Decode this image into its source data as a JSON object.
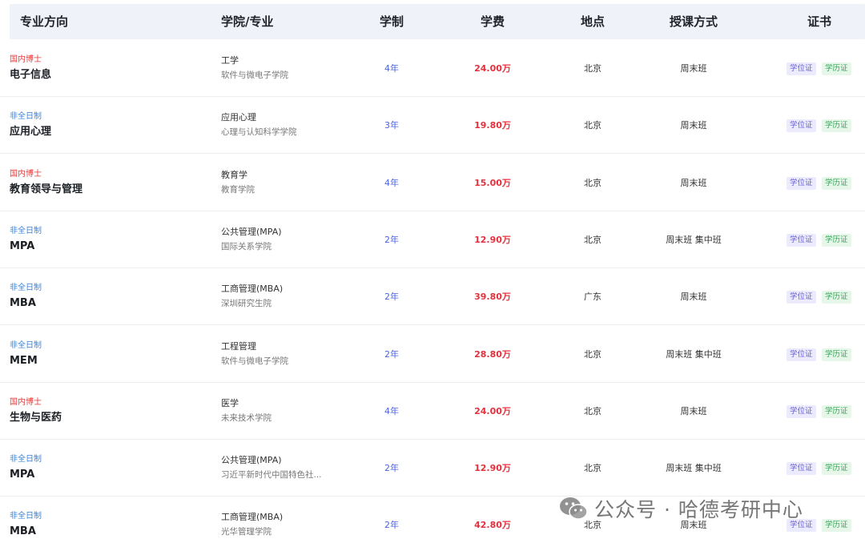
{
  "header": {
    "col_direction": "专业方向",
    "col_program": "学院/专业",
    "col_years": "学制",
    "col_fee": "学费",
    "col_location": "地点",
    "col_mode": "授课方式",
    "col_cert": "证书"
  },
  "rows": [
    {
      "tag": "国内博士",
      "tag_type": "doc",
      "major": "电子信息",
      "program": "工学",
      "school": "软件与微电子学院",
      "years": "4年",
      "fee": "24.00万",
      "location": "北京",
      "mode": "周末班",
      "cert1": "学位证",
      "cert2": "学历证"
    },
    {
      "tag": "非全日制",
      "tag_type": "part",
      "major": "应用心理",
      "program": "应用心理",
      "school": "心理与认知科学学院",
      "years": "3年",
      "fee": "19.80万",
      "location": "北京",
      "mode": "周末班",
      "cert1": "学位证",
      "cert2": "学历证"
    },
    {
      "tag": "国内博士",
      "tag_type": "doc",
      "major": "教育领导与管理",
      "program": "教育学",
      "school": "教育学院",
      "years": "4年",
      "fee": "15.00万",
      "location": "北京",
      "mode": "周末班",
      "cert1": "学位证",
      "cert2": "学历证"
    },
    {
      "tag": "非全日制",
      "tag_type": "part",
      "major": "MPA",
      "program": "公共管理(MPA)",
      "school": "国际关系学院",
      "years": "2年",
      "fee": "12.90万",
      "location": "北京",
      "mode": "周末班 集中班",
      "cert1": "学位证",
      "cert2": "学历证"
    },
    {
      "tag": "非全日制",
      "tag_type": "part",
      "major": "MBA",
      "program": "工商管理(MBA)",
      "school": "深圳研究生院",
      "years": "2年",
      "fee": "39.80万",
      "location": "广东",
      "mode": "周末班",
      "cert1": "学位证",
      "cert2": "学历证"
    },
    {
      "tag": "非全日制",
      "tag_type": "part",
      "major": "MEM",
      "program": "工程管理",
      "school": "软件与微电子学院",
      "years": "2年",
      "fee": "28.80万",
      "location": "北京",
      "mode": "周末班 集中班",
      "cert1": "学位证",
      "cert2": "学历证"
    },
    {
      "tag": "国内博士",
      "tag_type": "doc",
      "major": "生物与医药",
      "program": "医学",
      "school": "未来技术学院",
      "years": "4年",
      "fee": "24.00万",
      "location": "北京",
      "mode": "周末班",
      "cert1": "学位证",
      "cert2": "学历证"
    },
    {
      "tag": "非全日制",
      "tag_type": "part",
      "major": "MPA",
      "program": "公共管理(MPA)",
      "school": "习近平新时代中国特色社...",
      "years": "2年",
      "fee": "12.90万",
      "location": "北京",
      "mode": "周末班 集中班",
      "cert1": "学位证",
      "cert2": "学历证"
    },
    {
      "tag": "非全日制",
      "tag_type": "part",
      "major": "MBA",
      "program": "工商管理(MBA)",
      "school": "光华管理学院",
      "years": "2年",
      "fee": "42.80万",
      "location": "北京",
      "mode": "周末班",
      "cert1": "学位证",
      "cert2": "学历证"
    }
  ],
  "watermark": {
    "text": "公众号 · 哈德考研中心",
    "icon": "wechat-icon"
  },
  "colors": {
    "header_bg": "#eff2f8",
    "doc_tag": "#e23c3c",
    "part_tag": "#3b82d6",
    "years": "#4b63e6",
    "fee": "#e5313d",
    "badge_degree_bg": "#ecebfd",
    "badge_edu_bg": "#e6f7ea"
  }
}
